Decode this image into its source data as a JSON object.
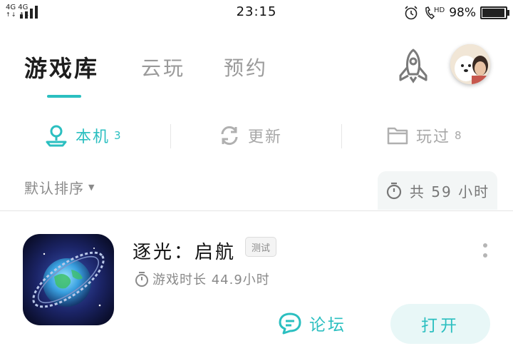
{
  "status_bar": {
    "network_top": "4G 4G",
    "network_bottom": "↑↓ ↑↓",
    "time": "23:15",
    "battery_percent_text": "98%",
    "battery_level": 0.98,
    "icons": [
      "alarm-icon",
      "hd-call-icon"
    ],
    "hd_label": "HD"
  },
  "top_tabs": [
    {
      "label": "游戏库",
      "active": true
    },
    {
      "label": "云玩",
      "active": false
    },
    {
      "label": "预约",
      "active": false
    }
  ],
  "sub_tabs": [
    {
      "label": "本机",
      "count": "3",
      "icon": "location-icon",
      "active": true
    },
    {
      "label": "更新",
      "count": "",
      "icon": "refresh-icon",
      "active": false
    },
    {
      "label": "玩过",
      "count": "8",
      "icon": "folder-icon",
      "active": false
    }
  ],
  "sort": {
    "label": "默认排序"
  },
  "total_time": {
    "label": "共 59 小时"
  },
  "games": [
    {
      "title": "逐光：启航",
      "badge": "测试",
      "playtime": "游戏时长 44.9小时",
      "forum_label": "论坛",
      "open_label": "打开"
    }
  ],
  "colors": {
    "accent": "#2bbfc0",
    "open_bg": "#e8f7f7",
    "text_muted": "#9a9a9a"
  }
}
